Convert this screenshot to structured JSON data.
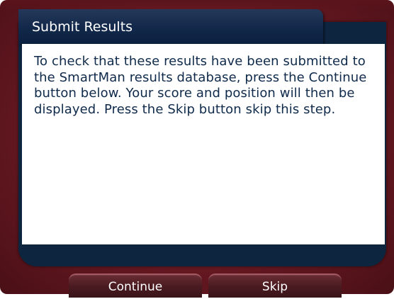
{
  "dialog": {
    "title": "Submit Results",
    "message": "To check that these results have been submitted to the SmartMan results database, press the Continue button below. Your score and position will then be displayed. Press the Skip button skip this step."
  },
  "buttons": {
    "continue_label": "Continue",
    "skip_label": "Skip"
  },
  "colors": {
    "frame": "#6e1b24",
    "header": "#12284a",
    "text": "#0f2a4a",
    "button": "#4a1b21"
  }
}
